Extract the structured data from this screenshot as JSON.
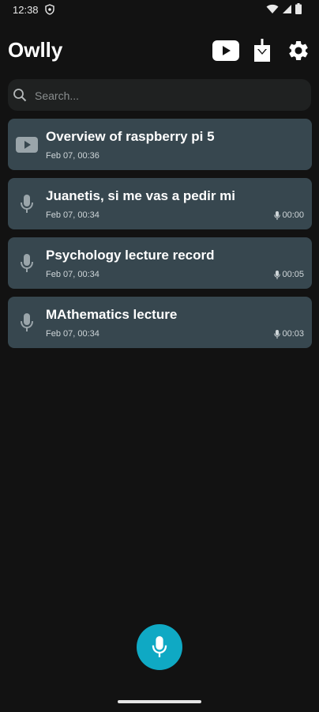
{
  "status_bar": {
    "time": "12:38",
    "icons": [
      "vpn-shield-icon",
      "wifi-icon",
      "cellular-signal-icon",
      "battery-icon"
    ]
  },
  "header": {
    "title": "Owlly",
    "actions": [
      "youtube-icon",
      "download-icon",
      "settings-gear-icon"
    ]
  },
  "search": {
    "placeholder": "Search..."
  },
  "recordings": [
    {
      "icon": "youtube-icon",
      "title": "Overview of raspberry pi 5",
      "date": "Feb 07, 00:36",
      "duration": ""
    },
    {
      "icon": "microphone-icon",
      "title": "Juanetis, si me vas a pedir mi",
      "date": "Feb 07, 00:34",
      "duration": "00:00"
    },
    {
      "icon": "microphone-icon",
      "title": "Psychology lecture record",
      "date": "Feb 07, 00:34",
      "duration": "00:05"
    },
    {
      "icon": "microphone-icon",
      "title": "MAthematics lecture",
      "date": "Feb 07, 00:34",
      "duration": "00:03"
    }
  ],
  "fab": {
    "icon": "microphone-icon"
  },
  "colors": {
    "background": "#121212",
    "card": "#37474f",
    "search_bg": "#1f2121",
    "accent": "#0fa9c4"
  }
}
